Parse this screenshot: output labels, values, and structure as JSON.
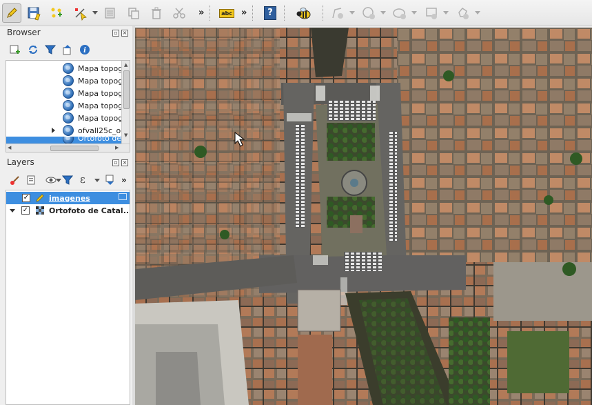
{
  "toolbar": {
    "overflow_glyph": "»",
    "overflow_glyph_2": "»",
    "overflow_glyph_3": "»",
    "label_tool_text": "abc",
    "help_tool_text": "?"
  },
  "browser_panel": {
    "title": "Browser",
    "items": [
      {
        "label": "Mapa topog"
      },
      {
        "label": "Mapa topog"
      },
      {
        "label": "Mapa topog"
      },
      {
        "label": "Mapa topog"
      },
      {
        "label": "Mapa topog"
      },
      {
        "label": "ofvall25c_o"
      },
      {
        "label": "Ortofoto de"
      }
    ]
  },
  "layers_panel": {
    "title": "Layers",
    "overflow_glyph": "»",
    "expression_glyph": "ε",
    "layers": [
      {
        "name": "imagenes",
        "checked": true,
        "selected": true
      },
      {
        "name": "Ortofoto de Catal...",
        "checked": true,
        "selected": false
      }
    ]
  },
  "colors": {
    "selection": "#3d8ee0",
    "accent_yellow": "#f2c81e"
  }
}
